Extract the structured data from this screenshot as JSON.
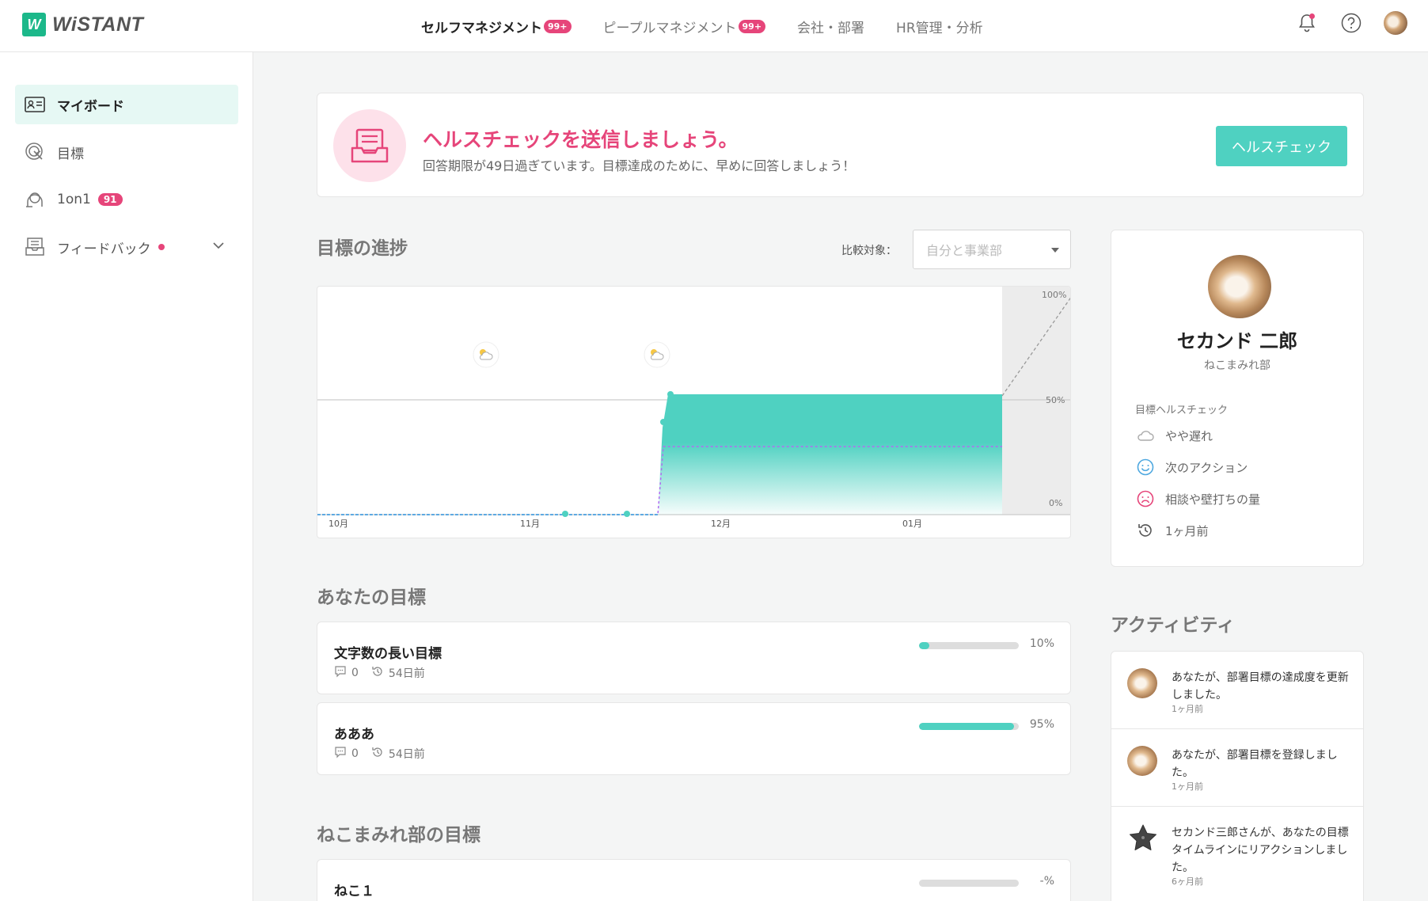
{
  "header": {
    "logo_mark": "W",
    "logo_text": "WiSTANT",
    "nav": [
      {
        "label": "セルフマネジメント",
        "badge": "99+"
      },
      {
        "label": "ピープルマネジメント",
        "badge": "99+"
      },
      {
        "label": "会社・部署",
        "badge": ""
      },
      {
        "label": "HR管理・分析",
        "badge": ""
      }
    ]
  },
  "sidebar": {
    "items": [
      {
        "label": "マイボード"
      },
      {
        "label": "目標"
      },
      {
        "label": "1on1",
        "badge": "91"
      },
      {
        "label": "フィードバック"
      }
    ]
  },
  "health_banner": {
    "title": "ヘルスチェックを送信しましょう。",
    "subtitle": "回答期限が49日過ぎています。目標達成のために、早めに回答しましょう！",
    "button": "ヘルスチェック"
  },
  "progress": {
    "title": "目標の進捗",
    "compare_label": "比較対象：",
    "compare_placeholder": "自分と事業部"
  },
  "chart_data": {
    "type": "area",
    "x_ticks": [
      "10月",
      "11月",
      "12月",
      "01月"
    ],
    "y_ticks": [
      "100%",
      "50%",
      "0%"
    ],
    "ylim": [
      0,
      100
    ],
    "grid": true
  },
  "your_goals": {
    "title": "あなたの目標",
    "items": [
      {
        "title": "文字数の長い目標",
        "comments": "0",
        "updated": "54日前",
        "progress": 0.1,
        "pct": "10%"
      },
      {
        "title": "あああ",
        "comments": "0",
        "updated": "54日前",
        "progress": 0.95,
        "pct": "95%"
      }
    ]
  },
  "dept_goals": {
    "title": "ねこまみれ部の目標",
    "items": [
      {
        "title": "ねこ１",
        "progress": 0,
        "pct": "-%"
      }
    ]
  },
  "profile": {
    "name": "セカンド 二郎",
    "dept": "ねこまみれ部",
    "health_label": "目標ヘルスチェック",
    "rows": [
      {
        "label": "やや遅れ"
      },
      {
        "label": "次のアクション"
      },
      {
        "label": "相談や壁打ちの量"
      },
      {
        "label": "1ヶ月前"
      }
    ]
  },
  "activity": {
    "title": "アクティビティ",
    "items": [
      {
        "text": "あなたが、部署目標の達成度を更新しました。",
        "time": "1ヶ月前"
      },
      {
        "text": "あなたが、部署目標を登録しました。",
        "time": "1ヶ月前"
      },
      {
        "text": "セカンド三郎さんが、あなたの目標タイムラインにリアクションしました。",
        "time": "6ヶ月前"
      }
    ]
  },
  "colors": {
    "brand": "#1cb88a",
    "accent": "#4fd1c1",
    "alert": "#e6457a"
  }
}
